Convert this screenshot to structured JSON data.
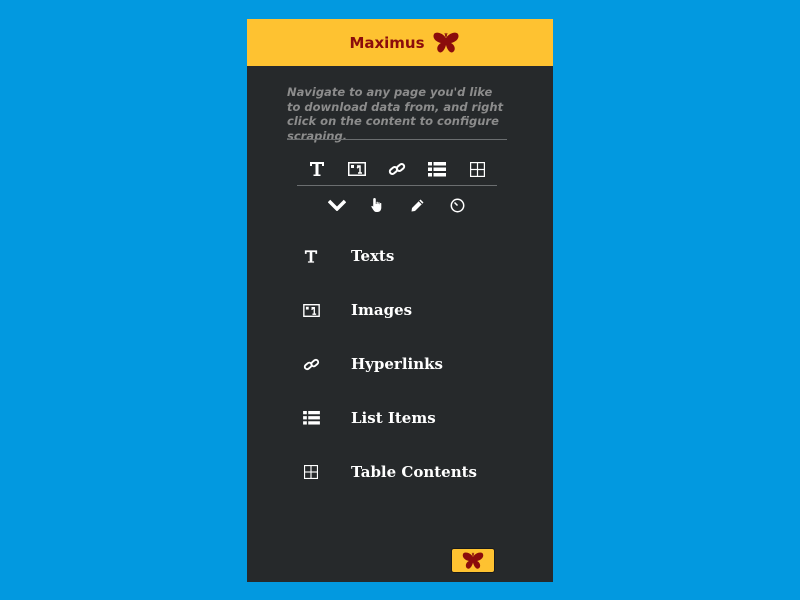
{
  "header": {
    "title": "Maximus",
    "logo_icon": "butterfly-icon",
    "background": "#fec231",
    "title_color": "#8b0c0c"
  },
  "instructions": "Navigate to any page you'd like to download data from, and right click on the content to configure scraping.",
  "toolbar_top": [
    {
      "icon": "text-icon",
      "tooltip": "Texts"
    },
    {
      "icon": "image-icon",
      "tooltip": "Images"
    },
    {
      "icon": "link-icon",
      "tooltip": "Hyperlinks"
    },
    {
      "icon": "list-icon",
      "tooltip": "List Items"
    },
    {
      "icon": "table-icon",
      "tooltip": "Table Contents"
    }
  ],
  "toolbar_bottom": [
    {
      "icon": "chevron-down-icon"
    },
    {
      "icon": "hand-pointer-icon"
    },
    {
      "icon": "pencil-icon"
    },
    {
      "icon": "clock-icon"
    }
  ],
  "menu": {
    "items": [
      {
        "label": "Texts",
        "icon": "text-icon"
      },
      {
        "label": "Images",
        "icon": "image-icon"
      },
      {
        "label": "Hyperlinks",
        "icon": "link-icon"
      },
      {
        "label": "List Items",
        "icon": "list-icon"
      },
      {
        "label": "Table Contents",
        "icon": "table-icon"
      }
    ]
  },
  "footer": {
    "button_icon": "butterfly-icon"
  },
  "colors": {
    "page_background": "#0299e0",
    "panel_background": "#26292b",
    "accent": "#fec231",
    "brand_red": "#8b0c0c"
  }
}
